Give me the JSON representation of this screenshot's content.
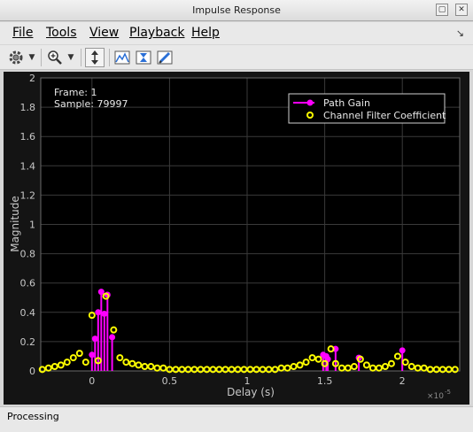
{
  "window": {
    "title": "Impulse Response"
  },
  "menu": {
    "items": [
      {
        "label": "File",
        "mnemonic_index": 0
      },
      {
        "label": "Tools",
        "mnemonic_index": 0
      },
      {
        "label": "View",
        "mnemonic_index": 0
      },
      {
        "label": "Playback",
        "mnemonic_index": 0
      },
      {
        "label": "Help",
        "mnemonic_index": 0
      }
    ]
  },
  "toolbar": {
    "buttons": [
      {
        "name": "settings-button",
        "icon": "gear-icon"
      },
      {
        "name": "settings-dropdown",
        "icon": "chevron-down-icon"
      },
      {
        "name": "zoom-in-button",
        "icon": "zoom-in-icon"
      },
      {
        "name": "zoom-dropdown",
        "icon": "chevron-down-icon"
      },
      {
        "name": "scale-y-button",
        "icon": "scale-y-icon"
      },
      {
        "name": "peak-finder-button",
        "icon": "peak-finder-icon"
      },
      {
        "name": "triggers-button",
        "icon": "triggers-icon"
      },
      {
        "name": "style-button",
        "icon": "pen-icon"
      }
    ]
  },
  "status": {
    "text": "Processing"
  },
  "overlay": {
    "frame": "Frame: 1",
    "sample": "Sample: 79997"
  },
  "colors": {
    "background": "#000000",
    "grid": "#3a3a3a",
    "axis_text": "#c8c8c8",
    "path_gain": "#ff00ff",
    "filter_coeff": "#ffff00"
  },
  "chart_data": {
    "type": "scatter",
    "xlabel": "Delay (s)",
    "ylabel": "Magnitude",
    "x_exponent_label": "×10",
    "x_exponent_value": "-5",
    "xlim": [
      -0.33,
      2.37
    ],
    "ylim": [
      0,
      2
    ],
    "xticks": [
      0,
      0.5,
      1,
      1.5,
      2
    ],
    "xtick_labels": [
      "0",
      "0.5",
      "1",
      "1.5",
      "2"
    ],
    "yticks": [
      0,
      0.2,
      0.4,
      0.6,
      0.8,
      1,
      1.2,
      1.4,
      1.6,
      1.8,
      2
    ],
    "ytick_labels": [
      "0",
      "0.2",
      "0.4",
      "0.6",
      "0.8",
      "1",
      "1.2",
      "1.4",
      "1.6",
      "1.8",
      "2"
    ],
    "grid": true,
    "legend_position": "top-right",
    "series": [
      {
        "name": "Path Gain",
        "style": "stem",
        "x": [
          0.0,
          0.02,
          0.04,
          0.06,
          0.08,
          0.1,
          0.13,
          1.49,
          1.51,
          1.52,
          1.57,
          1.72,
          2.0
        ],
        "values": [
          0.11,
          0.22,
          0.4,
          0.54,
          0.39,
          0.52,
          0.23,
          0.11,
          0.1,
          0.08,
          0.15,
          0.09,
          0.14
        ]
      },
      {
        "name": "Channel Filter Coefficient",
        "style": "marker",
        "x": [
          -0.32,
          -0.28,
          -0.24,
          -0.2,
          -0.16,
          -0.12,
          -0.08,
          -0.04,
          0.0,
          0.04,
          0.09,
          0.14,
          0.18,
          0.22,
          0.26,
          0.3,
          0.34,
          0.38,
          0.42,
          0.46,
          0.5,
          0.54,
          0.58,
          0.62,
          0.66,
          0.7,
          0.74,
          0.78,
          0.82,
          0.86,
          0.9,
          0.94,
          0.98,
          1.02,
          1.06,
          1.1,
          1.14,
          1.18,
          1.22,
          1.26,
          1.3,
          1.34,
          1.38,
          1.42,
          1.46,
          1.5,
          1.54,
          1.57,
          1.61,
          1.65,
          1.69,
          1.73,
          1.77,
          1.81,
          1.85,
          1.89,
          1.93,
          1.97,
          2.02,
          2.06,
          2.1,
          2.14,
          2.18,
          2.22,
          2.26,
          2.3,
          2.34
        ],
        "values": [
          0.01,
          0.02,
          0.03,
          0.04,
          0.06,
          0.09,
          0.12,
          0.06,
          0.38,
          0.07,
          0.51,
          0.28,
          0.09,
          0.06,
          0.05,
          0.04,
          0.03,
          0.03,
          0.02,
          0.02,
          0.01,
          0.01,
          0.01,
          0.01,
          0.01,
          0.01,
          0.01,
          0.01,
          0.01,
          0.01,
          0.01,
          0.01,
          0.01,
          0.01,
          0.01,
          0.01,
          0.01,
          0.01,
          0.02,
          0.02,
          0.03,
          0.04,
          0.06,
          0.09,
          0.08,
          0.05,
          0.15,
          0.05,
          0.02,
          0.02,
          0.03,
          0.08,
          0.04,
          0.02,
          0.02,
          0.03,
          0.05,
          0.1,
          0.06,
          0.03,
          0.02,
          0.02,
          0.01,
          0.01,
          0.01,
          0.01,
          0.01
        ]
      }
    ]
  }
}
